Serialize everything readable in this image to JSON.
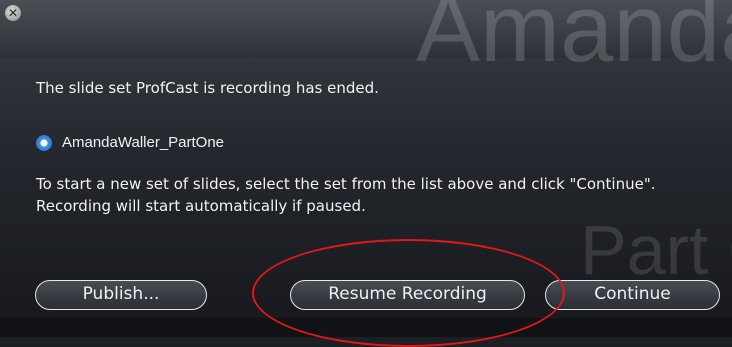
{
  "background": {
    "title_text": "Amanda",
    "subtitle_text": "Part C"
  },
  "dialog": {
    "close_glyph": "✕",
    "message": "The slide set ProfCast is recording has ended.",
    "slide_set": {
      "icon": "disk-icon",
      "name": "AmandaWaller_PartOne"
    },
    "instructions": "To start a new set of slides, select the set from the list above and click \"Continue\". Recording will start automatically if paused."
  },
  "buttons": {
    "publish": "Publish...",
    "resume": "Resume Recording",
    "continue": "Continue"
  },
  "colors": {
    "panel": "#24272d",
    "text": "#f2f2f2",
    "annotation": "#e01818",
    "icon_blue": "#3f93e8"
  }
}
